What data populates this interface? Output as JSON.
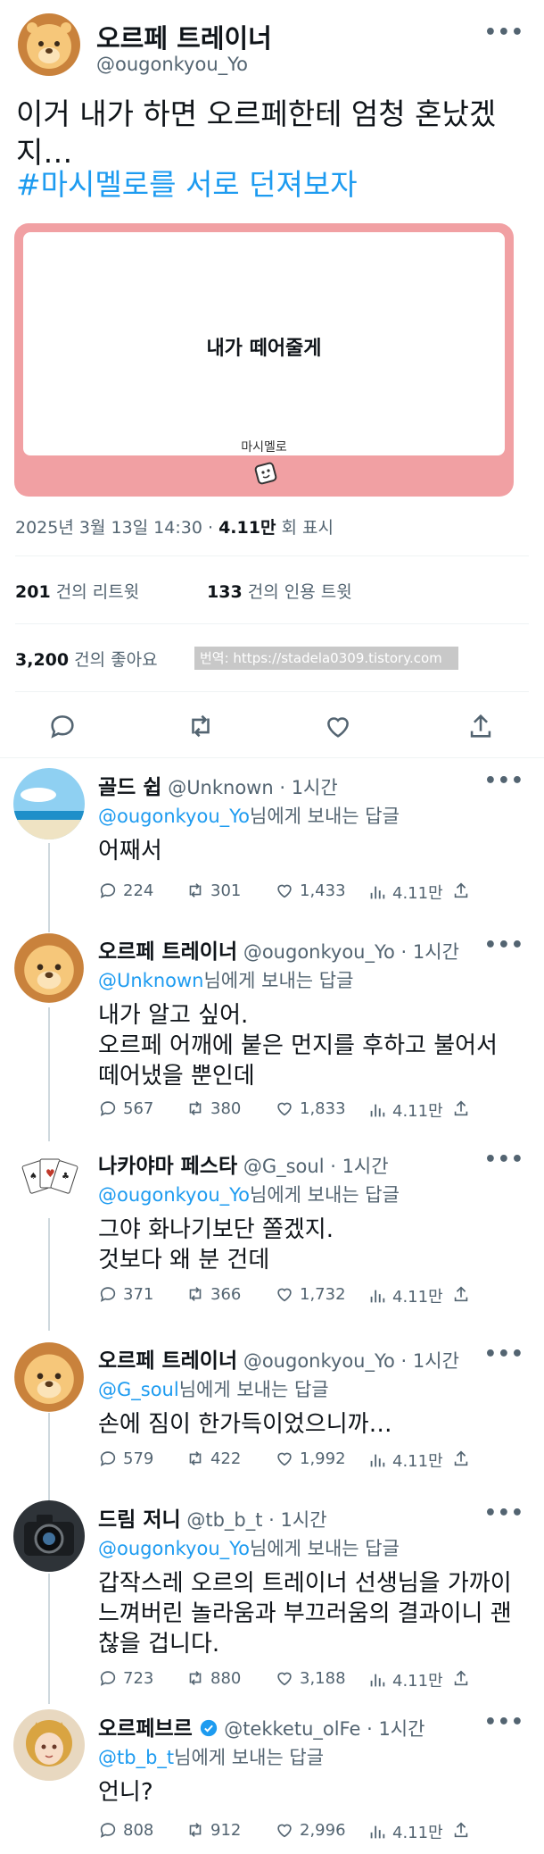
{
  "main": {
    "display_name": "오르페 트레이너",
    "handle": "@ougonkyou_Yo",
    "text": "이거 내가 하면 오르페한테 엄청 혼났겠지…",
    "hashtag": "#마시멜로를 서로 던져보자",
    "card": {
      "title": "내가 떼어줄게",
      "subtitle": "마시멜로",
      "color": "#f1a0a3"
    },
    "meta": {
      "date": "2025년 3월 13일 14:30 · ",
      "views": "4.11만",
      "views_suffix": " 회 표시"
    },
    "stats": {
      "retweets": "201",
      "retweets_label": "건의 리트윗",
      "quotes": "133",
      "quotes_label": "건의 인용 트윗",
      "likes": "3,200",
      "likes_label": "건의 좋아요"
    },
    "watermark": "번역: https://stadela0309.tistory.com",
    "actions": [
      "reply-icon",
      "retweet-icon",
      "like-icon",
      "share-icon"
    ]
  },
  "reply_prefix_suffix": "님에게 보내는 답글",
  "replies": [
    {
      "display_name": "골드 쉽",
      "handle": "@Unknown",
      "time": " · 1시간",
      "to": "@ougonkyou_Yo",
      "text": "어째서",
      "replies": "224",
      "retweets": "301",
      "likes": "1,433",
      "views": "4.11만"
    },
    {
      "display_name": "오르페 트레이너",
      "handle": "@ougonkyou_Yo",
      "time": " · 1시간",
      "to": "@Unknown",
      "text": "내가 알고 싶어.\n오르페 어깨에 붙은 먼지를 후하고 불어서 떼어냈을 뿐인데",
      "replies": "567",
      "retweets": "380",
      "likes": "1,833",
      "views": "4.11만"
    },
    {
      "display_name": "나카야마 페스타",
      "handle": "@G_soul",
      "time": " · 1시간",
      "to": "@ougonkyou_Yo",
      "text": "그야 화나기보단 쫄겠지.\n것보다 왜 분 건데",
      "replies": "371",
      "retweets": "366",
      "likes": "1,732",
      "views": "4.11만"
    },
    {
      "display_name": "오르페 트레이너",
      "handle": "@ougonkyou_Yo",
      "time": " · 1시간",
      "to": "@G_soul",
      "text": "손에 짐이 한가득이었으니까…",
      "replies": "579",
      "retweets": "422",
      "likes": "1,992",
      "views": "4.11만"
    },
    {
      "display_name": "드림 저니",
      "handle": "@tb_b_t",
      "time": " · 1시간",
      "to": "@ougonkyou_Yo",
      "text": "갑작스레 오르의 트레이너 선생님을 가까이 느껴버린 놀라움과 부끄러움의 결과이니 괜찮을 겁니다.",
      "replies": "723",
      "retweets": "880",
      "likes": "3,188",
      "views": "4.11만"
    },
    {
      "display_name": "오르페브르",
      "handle": "@tekketu_olFe",
      "time": " · 1시간",
      "to": "@tb_b_t",
      "text": "언니?",
      "replies": "808",
      "retweets": "912",
      "likes": "2,996",
      "views": "4.11만",
      "verified": true
    }
  ],
  "colors": {
    "link": "#1d9bf0",
    "muted": "#536471",
    "verified": "#1d9bf0"
  }
}
